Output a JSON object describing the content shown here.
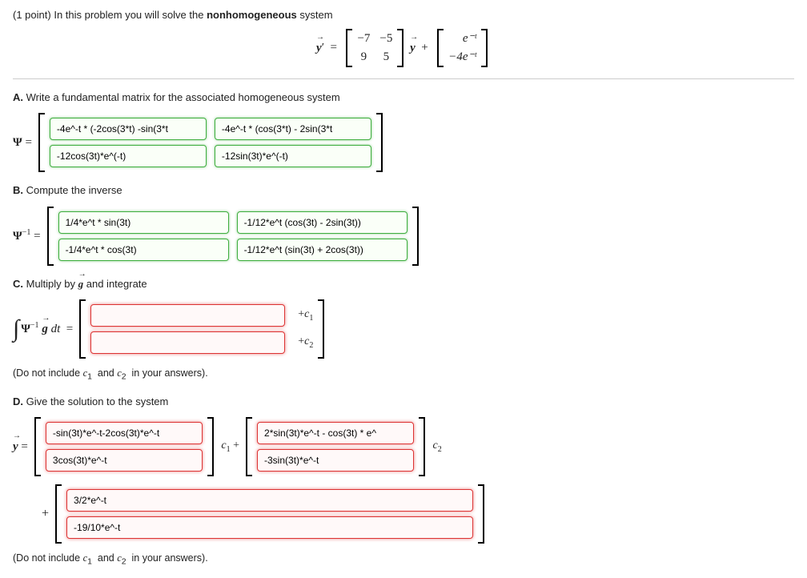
{
  "header": {
    "points": "(1 point)",
    "intro_a": "In this problem you will solve the ",
    "intro_b": "nonhomogeneous",
    "intro_c": " system"
  },
  "top_eq": {
    "lhs": "y′  =",
    "m11": "−7",
    "m12": "−5",
    "m21": "9",
    "m22": "5",
    "mid": "y  +",
    "v1": "e⁻ᵗ",
    "v2": "−4e⁻ᵗ"
  },
  "A": {
    "label": "A.",
    "text": " Write a fundamental matrix for the associated homogeneous system",
    "lhs": "Ψ  =",
    "in11": "-4e^-t * (-2cos(3*t) -sin(3*t",
    "in12": "-4e^-t * (cos(3*t) - 2sin(3*t",
    "in21": "-12cos(3t)*e^(-t)",
    "in22": "-12sin(3t)*e^(-t)"
  },
  "B": {
    "label": "B.",
    "text": " Compute the inverse",
    "lhs": "Ψ⁻¹  =",
    "in11": "1/4*e^t * sin(3t)",
    "in12": "-1/12*e^t (cos(3t) - 2sin(3t))",
    "in21": "-1/4*e^t * cos(3t)",
    "in22": "-1/12*e^t (sin(3t) + 2cos(3t))"
  },
  "C": {
    "label": "C.",
    "text_a": " Multiply by ",
    "text_b": " and integrate",
    "g": "g",
    "lhs1": "∫",
    "lhs2": "Ψ⁻¹ g dt  =",
    "tail1": "+c₁",
    "tail2": "+c₂",
    "note": "(Do not include c₁  and c₂  in your answers)."
  },
  "D": {
    "label": "D.",
    "text": " Give the solution to the system",
    "lhs": "y  =",
    "r1c1": "-sin(3t)*e^-t-2cos(3t)*e^-t",
    "r1c2": "3cos(3t)*e^-t",
    "mid1": "c₁ +",
    "r2c1": "2*sin(3t)*e^-t - cos(3t) * e^",
    "r2c2": "-3sin(3t)*e^-t",
    "mid2": "c₂",
    "plus": "+",
    "p1": "3/2*e^-t",
    "p2": "-19/10*e^-t",
    "note": "(Do not include c₁  and c₂  in your answers)."
  }
}
